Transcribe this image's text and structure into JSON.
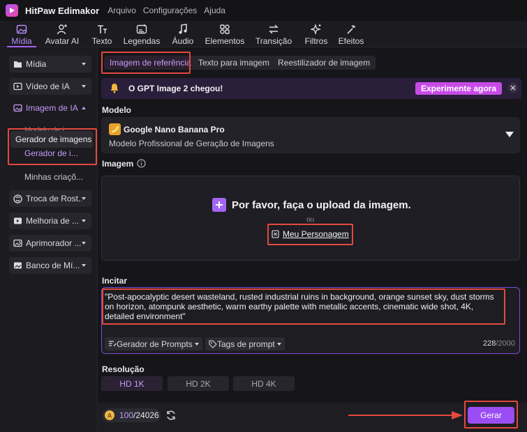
{
  "app": {
    "name": "HitPaw Edimakor",
    "menu": [
      "Arquivo",
      "Configurações",
      "Ajuda"
    ]
  },
  "toolbar": {
    "tools": [
      {
        "label": "Mídia",
        "icon": "media-icon",
        "active": true
      },
      {
        "label": "Avatar AI",
        "icon": "avatar-icon"
      },
      {
        "label": "Texto",
        "icon": "text-icon"
      },
      {
        "label": "Legendas",
        "icon": "subtitles-icon"
      },
      {
        "label": "Áudio",
        "icon": "music-note-icon"
      },
      {
        "label": "Elementos",
        "icon": "elements-icon"
      },
      {
        "label": "Transição",
        "icon": "transition-icon"
      },
      {
        "label": "Filtros",
        "icon": "sparkle-icon"
      },
      {
        "label": "Efeitos",
        "icon": "effects-icon"
      }
    ]
  },
  "sidebar": {
    "items": [
      {
        "label": "Mídia",
        "icon": "folder-icon"
      },
      {
        "label": "Vídeo de IA",
        "icon": "video-icon"
      },
      {
        "label": "Imagem de IA",
        "icon": "image-ai-icon",
        "open": true
      },
      {
        "label": "Troca de Rost...",
        "icon": "face-swap-icon"
      },
      {
        "label": "Melhoria de ...",
        "icon": "enhance-icon"
      },
      {
        "label": "Aprimorador ...",
        "icon": "enhancer-icon"
      },
      {
        "label": "Banco de Mí...",
        "icon": "media-bank-icon"
      }
    ],
    "sub_partial": "Modelo de i...",
    "sub_selected": "Gerador de i...",
    "sub_my": "Minhas criaçõ...",
    "tooltip": "Gerador de imagens"
  },
  "main": {
    "tabs": [
      "Imagem de referência",
      "Texto para imagem",
      "Reestilizador de imagem"
    ],
    "banner": {
      "text": "O GPT Image 2 chegou!",
      "cta": "Experimente agora"
    },
    "model": {
      "section": "Modelo",
      "name": "Google Nano Banana Pro",
      "desc": "Modelo Profissional de Geração de Imagens"
    },
    "image": {
      "section": "Imagem",
      "upload_text": "Por favor, faça o upload da imagem.",
      "or": "ou",
      "character_link": "Meu Personagem"
    },
    "prompt": {
      "section": "Incitar",
      "value": "\"Post-apocalyptic desert wasteland, rusted industrial ruins in background, orange sunset sky, dust storms on horizon, atompunk aesthetic, warm earthy palette with metallic accents, cinematic wide shot, 4K, detailed environment\"",
      "generator_chip": "Gerador de Prompts",
      "tags_chip": "Tags de prompt",
      "count": "228",
      "max": "/2000"
    },
    "resolution": {
      "section": "Resolução",
      "options": [
        "HD 1K",
        "HD 2K",
        "HD 4K"
      ]
    }
  },
  "footer": {
    "credits_used": "100",
    "credits_total": "/24026",
    "generate": "Gerar"
  },
  "colors": {
    "accent": "#a565f5",
    "banner_bg": "#2a1f3a",
    "cta": "#c84be8",
    "highlight": "#e5483f"
  }
}
